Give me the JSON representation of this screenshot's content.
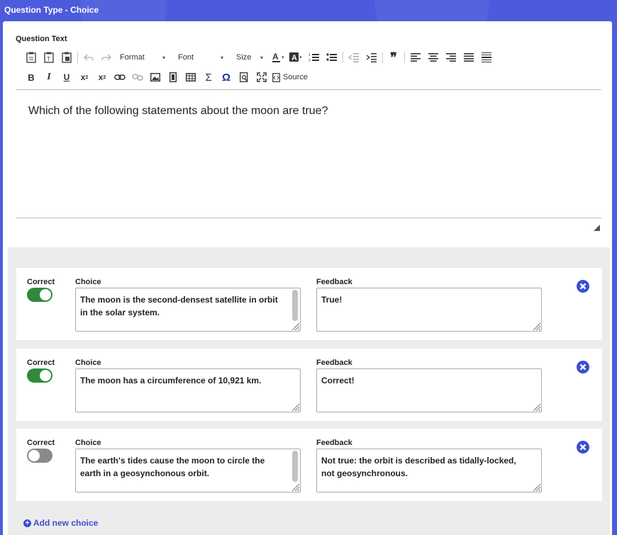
{
  "window": {
    "title": "Question Type - Choice"
  },
  "editor": {
    "label": "Question Text",
    "format_label": "Format",
    "font_label": "Font",
    "size_label": "Size",
    "source_label": "Source",
    "content": "Which of the following statements about the moon are true?"
  },
  "choices": [
    {
      "correct_label": "Correct",
      "correct": true,
      "choice_label": "Choice",
      "choice_text": "The moon is the second-densest satellite in orbit in the solar system.",
      "feedback_label": "Feedback",
      "feedback_text": "True!"
    },
    {
      "correct_label": "Correct",
      "correct": true,
      "choice_label": "Choice",
      "choice_text": "The moon has a circumference of 10,921 km.",
      "feedback_label": "Feedback",
      "feedback_text": "Correct!"
    },
    {
      "correct_label": "Correct",
      "correct": false,
      "choice_label": "Choice",
      "choice_text": "The earth's tides cause the moon to circle the earth in a geosynchonous orbit.",
      "feedback_label": "Feedback",
      "feedback_text": "Not true: the orbit is described as tidally-locked, not geosynchronous."
    }
  ],
  "add_choice_label": "Add new choice",
  "colors": {
    "accent": "#3a4fd0",
    "toggle_on": "#2f8a3c",
    "toggle_off": "#8a8a8a",
    "header": "#4c5bdc"
  }
}
